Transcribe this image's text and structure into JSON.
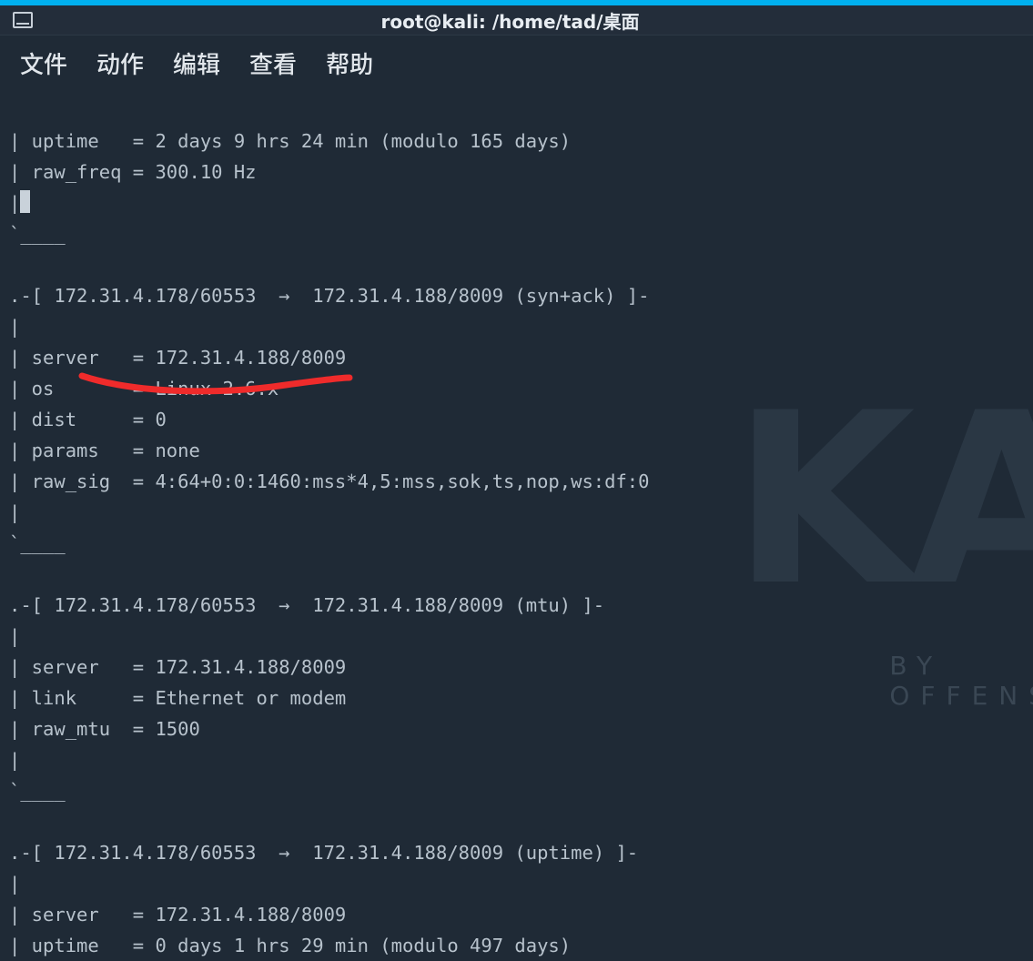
{
  "window": {
    "title": "root@kali: /home/tad/桌面"
  },
  "menu": {
    "file": "文件",
    "actions": "动作",
    "edit": "编辑",
    "view": "查看",
    "help": "帮助"
  },
  "watermark": {
    "big": "KA",
    "sub": "BY OFFENS"
  },
  "term": {
    "l01": "| uptime   = 2 days 9 hrs 24 min (modulo 165 days)",
    "l02": "| raw_freq = 300.10 Hz",
    "l03": "|",
    "l04": "`____",
    "l05": "",
    "l06": ".-[ 172.31.4.178/60553  →  172.31.4.188/8009 (syn+ack) ]-",
    "l07": "|",
    "l08": "| server   = 172.31.4.188/8009",
    "l09": "| os       = Linux 2.6.x",
    "l10": "| dist     = 0",
    "l11": "| params   = none",
    "l12": "| raw_sig  = 4:64+0:0:1460:mss*4,5:mss,sok,ts,nop,ws:df:0",
    "l13": "|",
    "l14": "`____",
    "l15": "",
    "l16": ".-[ 172.31.4.178/60553  →  172.31.4.188/8009 (mtu) ]-",
    "l17": "|",
    "l18": "| server   = 172.31.4.188/8009",
    "l19": "| link     = Ethernet or modem",
    "l20": "| raw_mtu  = 1500",
    "l21": "|",
    "l22": "`____",
    "l23": "",
    "l24": ".-[ 172.31.4.178/60553  →  172.31.4.188/8009 (uptime) ]-",
    "l25": "|",
    "l26": "| server   = 172.31.4.188/8009",
    "l27": "| uptime   = 0 days 1 hrs 29 min (modulo 497 days)"
  }
}
